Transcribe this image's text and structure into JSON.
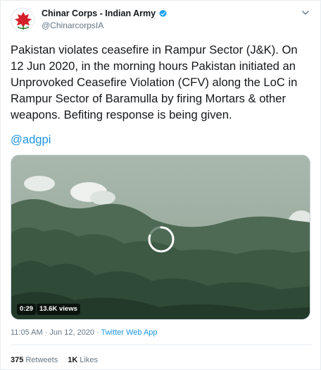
{
  "author": {
    "display_name": "Chinar Corps - Indian Army",
    "handle": "@ChinarcorpsIA"
  },
  "tweet": {
    "text": "Pakistan violates ceasefire in Rampur Sector (J&K). On 12 Jun 2020, in the morning hours Pakistan initiated an Unprovoked Ceasefire Violation (CFV) along the LoC in Rampur Sector of Baramulla by firing Mortars & other weapons. Befiting response is being given.",
    "mention": "@adgpi"
  },
  "video": {
    "duration": "0:29",
    "views": "13.6K views",
    "loading_progress": 0.8
  },
  "meta": {
    "timestamp": "11:05 AM · Jun 12, 2020",
    "separator": " · ",
    "source": "Twitter Web App"
  },
  "stats": {
    "retweets_count": "375",
    "retweets_label": "Retweets",
    "likes_count": "1K",
    "likes_label": "Likes"
  },
  "colors": {
    "accent": "#1b95e0",
    "text": "#14171a",
    "muted": "#657786"
  }
}
